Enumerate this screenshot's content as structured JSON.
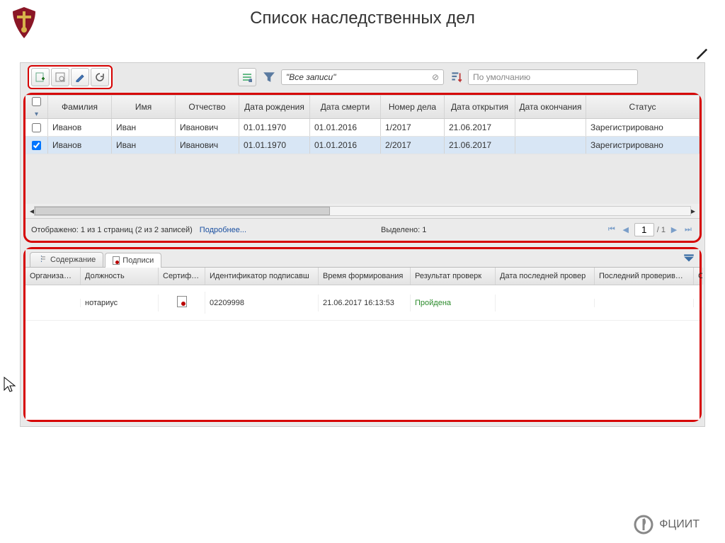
{
  "page": {
    "title": "Список наследственных дел"
  },
  "toolbar": {
    "filter_label": "\"Все записи\"",
    "sort_label": "По умолчанию"
  },
  "grid": {
    "headers": {
      "fam": "Фамилия",
      "imya": "Имя",
      "otch": "Отчество",
      "dr": "Дата рождения",
      "ds": "Дата смерти",
      "nd": "Номер дела",
      "do": "Дата открытия",
      "dk": "Дата окончания",
      "st": "Статус"
    },
    "rows": [
      {
        "checked": false,
        "fam": "Иванов",
        "imya": "Иван",
        "otch": "Иванович",
        "dr": "01.01.1970",
        "ds": "01.01.2016",
        "nd": "1/2017",
        "do": "21.06.2017",
        "dk": "",
        "st": "Зарегистрировано"
      },
      {
        "checked": true,
        "fam": "Иванов",
        "imya": "Иван",
        "otch": "Иванович",
        "dr": "01.01.1970",
        "ds": "01.01.2016",
        "nd": "2/2017",
        "do": "21.06.2017",
        "dk": "",
        "st": "Зарегистрировано"
      }
    ],
    "footer": {
      "shown": "Отображено: 1 из 1 страниц (2 из 2 записей)",
      "more": "Подробнее...",
      "selected": "Выделено: 1",
      "page_current": "1",
      "page_total": "/ 1"
    }
  },
  "tabs": {
    "content": "Содержание",
    "signatures": "Подписи"
  },
  "detail": {
    "headers": {
      "org": "Организация",
      "pos": "Должность",
      "cert": "Сертифика",
      "id": "Идентификатор подписавш",
      "time": "Время формирования",
      "res": "Результат проверк",
      "dlast": "Дата последней провер",
      "who": "Последний проверивший",
      "err": "Оши"
    },
    "row": {
      "org": "",
      "pos": "нотариус",
      "id": "02209998",
      "time": "21.06.2017 16:13:53",
      "res": "Пройдена",
      "dlast": "",
      "who": "",
      "err": ""
    }
  },
  "brand": {
    "name": "ФЦИИТ"
  }
}
